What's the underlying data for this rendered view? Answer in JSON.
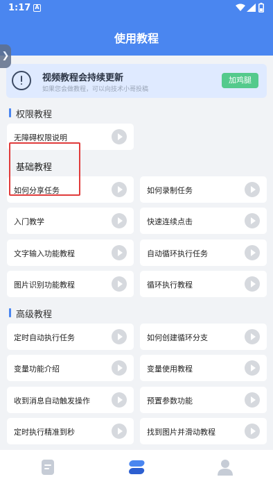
{
  "status": {
    "time": "1:17",
    "notif": "A"
  },
  "header": {
    "title": "使用教程",
    "side_handle": "❯"
  },
  "notice": {
    "title": "视频教程会持续更新",
    "subtitle": "如果您会做教程，可以向技术小哥投稿",
    "button": "加鸡腿"
  },
  "sections": {
    "permission": {
      "title": "权限教程",
      "items": [
        "无障碍权限说明"
      ]
    },
    "basic": {
      "title": "基础教程",
      "items": [
        "如何分享任务",
        "如何录制任务",
        "入门教学",
        "快速连续点击",
        "文字输入功能教程",
        "自动循环执行任务",
        "图片识别功能教程",
        "循环执行教程"
      ]
    },
    "advanced": {
      "title": "高级教程",
      "items": [
        "定时自动执行任务",
        "如何创建循环分支",
        "变量功能介绍",
        "变量使用教程",
        "收到消息自动触发操作",
        "预置参数功能",
        "定时执行精准到秒",
        "找到图片并滑动教程"
      ]
    }
  },
  "tabs": [
    {
      "name": "document-tab",
      "icon": "document-icon",
      "active": false
    },
    {
      "name": "tutorial-tab",
      "icon": "layers-icon",
      "active": true
    },
    {
      "name": "profile-tab",
      "icon": "person-icon",
      "active": false
    }
  ],
  "colors": {
    "primary": "#4a86f0",
    "accent_green": "#54ca8c",
    "highlight_red": "#e03a3a"
  }
}
